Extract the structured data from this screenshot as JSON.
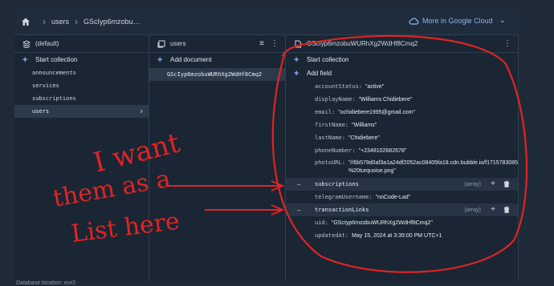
{
  "breadcrumb": {
    "items": [
      "users",
      "GScIyp6mzobu…"
    ],
    "cloud_link": "More in Google Cloud"
  },
  "panel_root": {
    "title": "(default)",
    "add_label": "Start collection",
    "collections": [
      "announcements",
      "services",
      "subscriptions",
      "users"
    ],
    "selected": "users"
  },
  "panel_collection": {
    "title": "users",
    "add_label": "Add document",
    "documents": [
      "GScIyp6mzobuWURhXg2WdHf8Cmq2"
    ]
  },
  "panel_document": {
    "title": "GScIyp6mzobuWURhXg2WdHf8Cmq2",
    "start_collection": "Start collection",
    "add_field": "Add field",
    "fields": [
      {
        "key": "accountStatus:",
        "value": "\"active\""
      },
      {
        "key": "displayName:",
        "value": "\"Williams Chidiebere\""
      },
      {
        "key": "email:",
        "value": "\"ochidiebere1995@gmail.com\""
      },
      {
        "key": "firstName:",
        "value": "\"Williams\""
      },
      {
        "key": "lastName:",
        "value": "\"Chidiebere\""
      },
      {
        "key": "phoneNumber:",
        "value": "\"+2348102682678\""
      },
      {
        "key": "photoURL:",
        "value": "\"//6b579d0af3a1a24df2052ac08405fa18.cdn.bubble.io/f171578308500 %20turquoise.png\""
      }
    ],
    "array1": {
      "key": "subscriptions",
      "type": "(array)"
    },
    "field_mid": {
      "key": "telegramUsername:",
      "value": "\"noCode-Lad\""
    },
    "array2": {
      "key": "transactionLinks",
      "type": "(array)"
    },
    "fields_after": [
      {
        "key": "uid:",
        "value": "\"GScIyp6mzobuWURhXg2WdHf8Cmq2\""
      },
      {
        "key": "updatedAt:",
        "value": "May 15, 2024 at 3:35:00 PM UTC+1"
      }
    ]
  },
  "status_text": "Database location: eur3",
  "annotation": {
    "lines": [
      "I want",
      "them as a",
      "List here"
    ],
    "color": "#e02424"
  },
  "colors": {
    "accent": "#8ab4f8",
    "bg": "#1a2634",
    "ink": "#e02424"
  }
}
